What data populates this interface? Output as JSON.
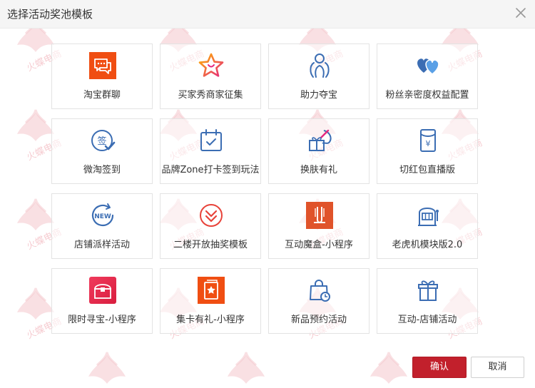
{
  "dialog": {
    "title": "选择活动奖池模板",
    "confirm_label": "确认",
    "cancel_label": "取消"
  },
  "watermark_text": "火蝶电商",
  "templates": [
    {
      "label": "淘宝群聊",
      "icon": "group-chat-icon"
    },
    {
      "label": "买家秀商家征集",
      "icon": "star-show-icon"
    },
    {
      "label": "助力夺宝",
      "icon": "people-assist-icon"
    },
    {
      "label": "粉丝亲密度权益配置",
      "icon": "hearts-icon"
    },
    {
      "label": "微淘签到",
      "icon": "checkin-icon"
    },
    {
      "label": "品牌Zone打卡签到玩法",
      "icon": "calendar-check-icon"
    },
    {
      "label": "换肤有礼",
      "icon": "palette-gift-icon"
    },
    {
      "label": "切红包直播版",
      "icon": "red-envelope-icon"
    },
    {
      "label": "店铺派样活动",
      "icon": "new-badge-icon"
    },
    {
      "label": "二楼开放抽奖模板",
      "icon": "double-chevron-down-icon"
    },
    {
      "label": "互动魔盒-小程序",
      "icon": "magic-box-icon"
    },
    {
      "label": "老虎机模块版2.0",
      "icon": "slot-machine-icon"
    },
    {
      "label": "限时寻宝-小程序",
      "icon": "treasure-chest-icon"
    },
    {
      "label": "集卡有礼-小程序",
      "icon": "card-collect-icon"
    },
    {
      "label": "新品预约活动",
      "icon": "bag-clock-icon"
    },
    {
      "label": "互动-店铺活动",
      "icon": "gift-box-icon"
    }
  ],
  "colors": {
    "accent_red": "#c2202c",
    "icon_blue": "#3b6db3",
    "icon_orange": "#f04e12"
  }
}
